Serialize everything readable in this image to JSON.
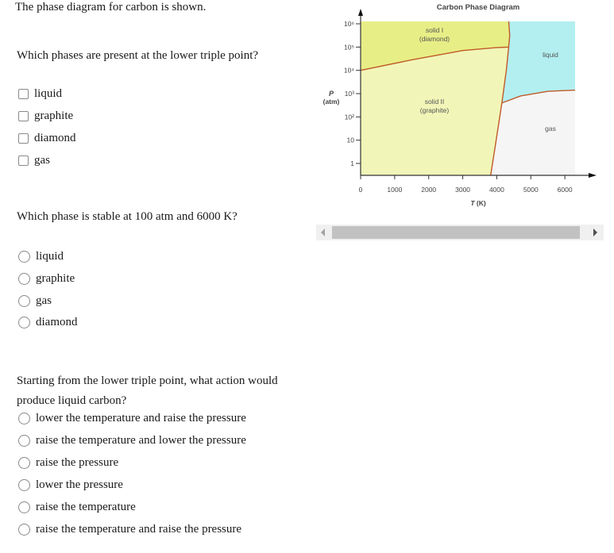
{
  "intro": "The phase diagram for carbon is shown.",
  "questions": [
    {
      "prompt": "Which phases are present at the lower triple point?",
      "type": "checkbox",
      "options": [
        "liquid",
        "graphite",
        "diamond",
        "gas"
      ]
    },
    {
      "prompt": "Which phase is stable at 100 atm and 6000 K?",
      "type": "radio",
      "options": [
        "liquid",
        "graphite",
        "gas",
        "diamond"
      ]
    },
    {
      "prompt": "Starting from the lower triple point, what action would produce liquid carbon?",
      "type": "radio",
      "options": [
        "lower the temperature and raise the pressure",
        "raise the temperature and lower the pressure",
        "raise the pressure",
        "lower the pressure",
        "raise the temperature",
        "raise the temperature and raise the pressure"
      ]
    }
  ],
  "chart_data": {
    "type": "area",
    "title": "Carbon Phase Diagram",
    "xlabel": "T (K)",
    "ylabel": "P (atm)",
    "ylabel_symbol": "P",
    "ylabel_unit": "(atm)",
    "xlabel_symbol": "T",
    "xlabel_unit": "(K)",
    "x_scale": "linear",
    "y_scale": "log10",
    "xlim": [
      0,
      6300
    ],
    "ylim_log10": [
      -0.6,
      6
    ],
    "x_ticks": [
      0,
      1000,
      2000,
      3000,
      4000,
      5000,
      6000
    ],
    "x_tick_labels": [
      "0",
      "1000",
      "2000",
      "3000",
      "4000",
      "5000",
      "6000"
    ],
    "y_ticks_log10": [
      0,
      1,
      2,
      3,
      4,
      5,
      6
    ],
    "y_tick_labels": [
      "1",
      "10",
      "10²",
      "10³",
      "10⁴",
      "10⁵",
      "10⁶"
    ],
    "regions": [
      {
        "name": "solid I (diamond)",
        "label_lines": [
          "solid I",
          "(diamond)"
        ],
        "color": "#e8ee86"
      },
      {
        "name": "solid II (graphite)",
        "label_lines": [
          "solid II",
          "(graphite)"
        ],
        "color": "#f1f6b8"
      },
      {
        "name": "liquid",
        "label_lines": [
          "liquid"
        ],
        "color": "#b3eff0"
      },
      {
        "name": "gas",
        "label_lines": [
          "gas"
        ],
        "color": "#f5f5f5"
      }
    ],
    "boundaries": [
      {
        "name": "diamond-graphite",
        "points": [
          [
            0,
            4.0
          ],
          [
            1500,
            4.45
          ],
          [
            3000,
            4.85
          ],
          [
            4000,
            4.98
          ],
          [
            4350,
            5.0
          ]
        ]
      },
      {
        "name": "diamond-liquid",
        "points": [
          [
            4350,
            5.0
          ],
          [
            4380,
            5.5
          ],
          [
            4350,
            6.0
          ]
        ]
      },
      {
        "name": "graphite-liquid",
        "points": [
          [
            4350,
            5.0
          ],
          [
            4280,
            4.0
          ],
          [
            4150,
            2.6
          ]
        ]
      },
      {
        "name": "graphite-gas",
        "points": [
          [
            4150,
            2.6
          ],
          [
            3950,
            0.7
          ],
          [
            3820,
            -0.6
          ]
        ]
      },
      {
        "name": "liquid-gas",
        "points": [
          [
            4150,
            2.6
          ],
          [
            4700,
            2.9
          ],
          [
            5500,
            3.1
          ],
          [
            6300,
            3.15
          ]
        ]
      }
    ],
    "triple_points": [
      {
        "name": "upper",
        "T": 4350,
        "log10P": 5.0,
        "phases": [
          "diamond",
          "graphite",
          "liquid"
        ]
      },
      {
        "name": "lower",
        "T": 4150,
        "log10P": 2.6,
        "phases": [
          "graphite",
          "liquid",
          "gas"
        ]
      }
    ],
    "boundary_color": "#c05a28",
    "grid": false,
    "legend": "none"
  },
  "scrollbar": {
    "label": "horizontal-scroll"
  }
}
